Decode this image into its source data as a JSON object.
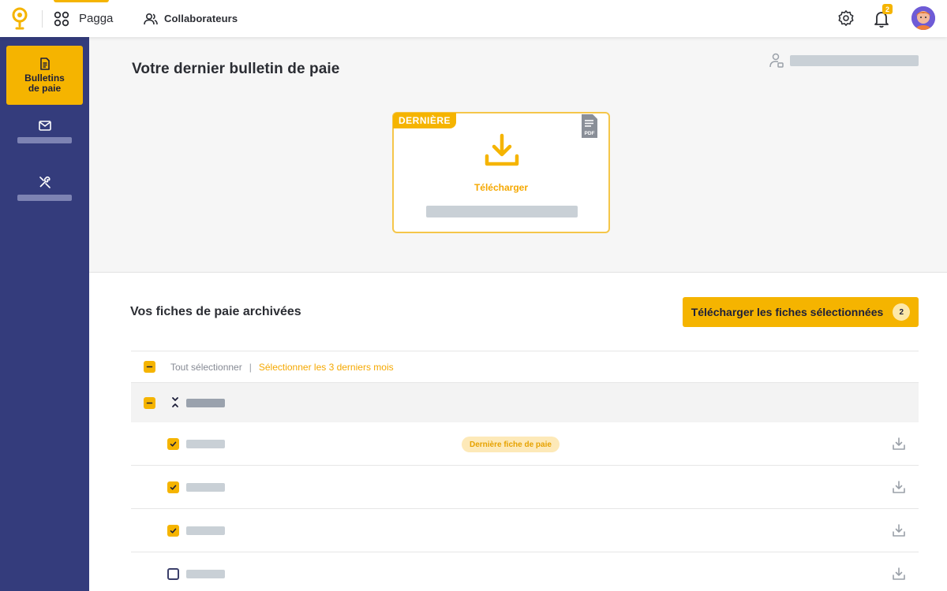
{
  "topbar": {
    "app_name": "Pagga",
    "collab_label": "Collaborateurs",
    "notifications_count": "2"
  },
  "sidebar": {
    "active_item": {
      "label": "Bulletins de paie",
      "icon": "document-icon"
    },
    "items": [
      {
        "icon": "mail-icon"
      },
      {
        "icon": "tools-icon"
      }
    ]
  },
  "latest": {
    "title": "Votre dernier bulletin de paie",
    "tag": "DERNIÈRE",
    "pdf_label": "PDF",
    "download_label": "Télécharger"
  },
  "archive": {
    "title": "Vos fiches de paie archivées",
    "download_selected_label": "Télécharger les fiches sélectionnées",
    "selected_count": "2",
    "select_all_label": "Tout sélectionner",
    "separator": "|",
    "select_last_label": "Sélectionner les 3 derniers mois",
    "rows": [
      {
        "checked": true,
        "badge": "Dernière fiche de paie"
      },
      {
        "checked": true
      },
      {
        "checked": true
      },
      {
        "checked": false
      }
    ]
  },
  "colors": {
    "accent": "#f5b400",
    "sidebar": "#343c7c",
    "badge_bg": "#fde9b8"
  }
}
